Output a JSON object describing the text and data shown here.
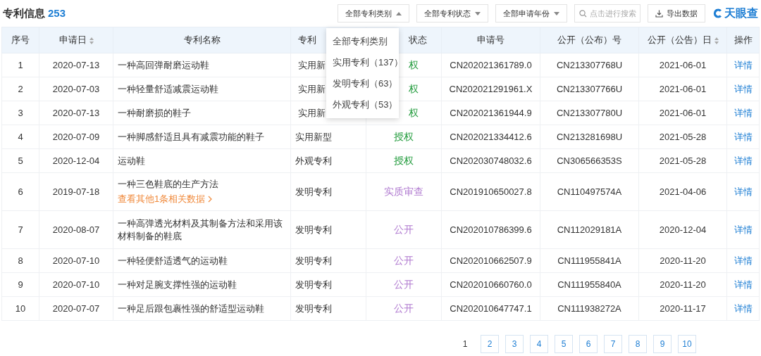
{
  "header": {
    "title": "专利信息",
    "count": "253"
  },
  "filters": [
    {
      "label": "全部专利类别",
      "expanded": true
    },
    {
      "label": "全部专利状态",
      "expanded": false
    },
    {
      "label": "全部申请年份",
      "expanded": false
    }
  ],
  "search": {
    "placeholder": "点击进行搜索"
  },
  "export_button": {
    "label": "导出数据"
  },
  "logo": {
    "text": "天眼查"
  },
  "dropdown": {
    "options": [
      "全部专利类别",
      "实用专利（137）",
      "发明专利（63）",
      "外观专利（53）"
    ]
  },
  "table": {
    "columns": [
      {
        "label": "序号",
        "sortable": false
      },
      {
        "label": "申请日",
        "sortable": true
      },
      {
        "label": "专利名称",
        "sortable": false
      },
      {
        "label": "专利",
        "sortable": false
      },
      {
        "label": "状态",
        "sortable": false
      },
      {
        "label": "申请号",
        "sortable": false
      },
      {
        "label": "公开（公布）号",
        "sortable": false
      },
      {
        "label": "公开（公告）日",
        "sortable": true
      },
      {
        "label": "操作",
        "sortable": false
      }
    ],
    "rows": [
      {
        "no": "1",
        "date": "2020-07-13",
        "name": "一种高回弹耐磨运动鞋",
        "type": "实用新",
        "status": "权",
        "color": "#1f9a3a",
        "app_no": "CN202021361789.0",
        "pub_no": "CN213307768U",
        "pub_date": "2021-06-01",
        "action": "详情"
      },
      {
        "no": "2",
        "date": "2020-07-03",
        "name": "一种轻量舒适减震运动鞋",
        "type": "实用新",
        "status": "权",
        "color": "#1f9a3a",
        "app_no": "CN202021291961.X",
        "pub_no": "CN213307766U",
        "pub_date": "2021-06-01",
        "action": "详情"
      },
      {
        "no": "3",
        "date": "2020-07-13",
        "name": "一种耐磨损的鞋子",
        "type": "实用新",
        "status": "权",
        "color": "#1f9a3a",
        "app_no": "CN202021361944.9",
        "pub_no": "CN213307780U",
        "pub_date": "2021-06-01",
        "action": "详情"
      },
      {
        "no": "4",
        "date": "2020-07-09",
        "name": "一种脚感舒适且具有减震功能的鞋子",
        "type": "实用新型",
        "status": "授权",
        "color": "#1f9a3a",
        "app_no": "CN202021334412.6",
        "pub_no": "CN213281698U",
        "pub_date": "2021-05-28",
        "action": "详情"
      },
      {
        "no": "5",
        "date": "2020-12-04",
        "name": "运动鞋",
        "type": "外观专利",
        "status": "授权",
        "color": "#1f9a3a",
        "app_no": "CN202030748032.6",
        "pub_no": "CN306566353S",
        "pub_date": "2021-05-28",
        "action": "详情"
      },
      {
        "no": "6",
        "date": "2019-07-18",
        "name": "一种三色鞋底的生产方法",
        "related_link": "查看其他1条相关数据",
        "type": "发明专利",
        "status": "实质审查",
        "color": "#b07ad0",
        "app_no": "CN201910650027.8",
        "pub_no": "CN110497574A",
        "pub_date": "2021-04-06",
        "action": "详情"
      },
      {
        "no": "7",
        "date": "2020-08-07",
        "name": "一种高弹透光材料及其制备方法和采用该材料制备的鞋底",
        "type": "发明专利",
        "status": "公开",
        "color": "#b07ad0",
        "app_no": "CN202010786399.6",
        "pub_no": "CN112029181A",
        "pub_date": "2020-12-04",
        "action": "详情"
      },
      {
        "no": "8",
        "date": "2020-07-10",
        "name": "一种轻便舒适透气的运动鞋",
        "type": "发明专利",
        "status": "公开",
        "color": "#b07ad0",
        "app_no": "CN202010662507.9",
        "pub_no": "CN111955841A",
        "pub_date": "2020-11-20",
        "action": "详情"
      },
      {
        "no": "9",
        "date": "2020-07-10",
        "name": "一种对足腕支撑性强的运动鞋",
        "type": "发明专利",
        "status": "公开",
        "color": "#b07ad0",
        "app_no": "CN202010660760.0",
        "pub_no": "CN111955840A",
        "pub_date": "2020-11-20",
        "action": "详情"
      },
      {
        "no": "10",
        "date": "2020-07-07",
        "name": "一种足后跟包裹性强的舒适型运动鞋",
        "type": "发明专利",
        "status": "公开",
        "color": "#b07ad0",
        "app_no": "CN202010647747.1",
        "pub_no": "CN111938272A",
        "pub_date": "2020-11-17",
        "action": "详情"
      }
    ]
  },
  "pagination": [
    {
      "label": "1",
      "selected": true
    },
    {
      "label": "2",
      "selected": false
    },
    {
      "label": "3",
      "selected": false
    },
    {
      "label": "4",
      "selected": false
    },
    {
      "label": "5",
      "selected": false
    },
    {
      "label": "6",
      "selected": false
    },
    {
      "label": "7",
      "selected": false
    },
    {
      "label": "8",
      "selected": false
    },
    {
      "label": "9",
      "selected": false
    },
    {
      "label": "10",
      "selected": false
    }
  ]
}
